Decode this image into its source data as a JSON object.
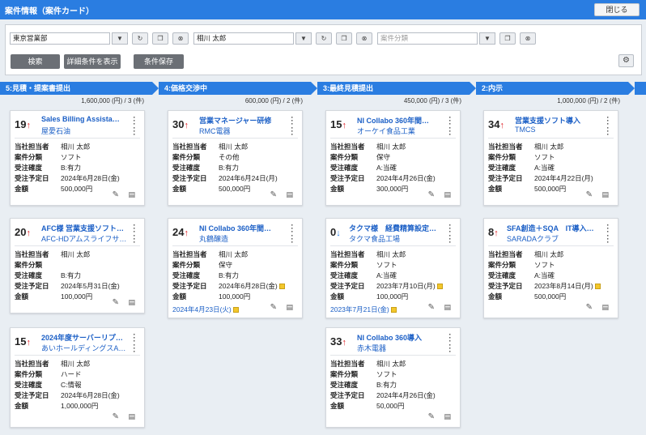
{
  "header": {
    "title": "案件情報（案件カード）",
    "close_label": "閉じる"
  },
  "filter": {
    "department": "東京営業部",
    "person": "相川 太郎",
    "category_placeholder": "案件分類",
    "search_label": "検索",
    "detail_label": "詳細条件を表示",
    "save_label": "条件保存"
  },
  "stages": [
    {
      "label": "5:見積・提案書提出",
      "summary": "1,600,000 (円) / 3 (件)"
    },
    {
      "label": "4:価格交渉中",
      "summary": "600,000 (円) / 2 (件)"
    },
    {
      "label": "3:最終見積提出",
      "summary": "450,000 (円) / 3 (件)"
    },
    {
      "label": "2:内示",
      "summary": "1,000,000 (円) / 2 (件)"
    }
  ],
  "field_labels": {
    "owner": "当社担当者",
    "category": "案件分類",
    "certainty": "受注確度",
    "due": "受注予定日",
    "amount": "金額"
  },
  "cards": [
    {
      "prob": "19",
      "name": "Sales Billing Assista…",
      "company": "屋愛石油",
      "owner": "相川 太郎",
      "category": "ソフト",
      "certainty": "B:有力",
      "due": "2024年6月28日(金)",
      "amount": "500,000円",
      "date": ""
    },
    {
      "prob": "20",
      "name": "AFC様 営業支援ソフト…",
      "company": "AFC-HDアムスライフサ…",
      "owner": "相川 太郎",
      "category": "",
      "certainty": "B:有力",
      "due": "2024年5月31日(金)",
      "amount": "100,000円",
      "date": ""
    },
    {
      "prob": "15",
      "name": "2024年度サーバーリプ…",
      "company": "あいホールディングスA…",
      "owner": "相川 太郎",
      "category": "ハード",
      "certainty": "C:情報",
      "due": "2024年6月28日(金)",
      "amount": "1,000,000円",
      "date": ""
    },
    {
      "prob": "30",
      "name": "営業マネージャー研修",
      "company": "RMC電器",
      "owner": "相川 太郎",
      "category": "その他",
      "certainty": "B:有力",
      "due": "2024年6月24日(月)",
      "amount": "500,000円",
      "date": ""
    },
    {
      "prob": "24",
      "name": "NI Collabo 360年間…",
      "company": "丸鶴醸造",
      "owner": "相川 太郎",
      "category": "保守",
      "certainty": "B:有力",
      "due": "2024年6月28日(金)",
      "amount": "100,000円",
      "date": "2024年4月23日(火)"
    },
    {
      "prob": "15",
      "name": "NI Collabo 360年間…",
      "company": "オーケイ食品工業",
      "owner": "相川 太郎",
      "category": "保守",
      "certainty": "A:当確",
      "due": "2024年4月26日(金)",
      "amount": "300,000円",
      "date": ""
    },
    {
      "prob": "0",
      "name": "タクマ様　経費精算設定…",
      "company": "タクマ食品工場",
      "owner": "相川 太郎",
      "category": "ソフト",
      "certainty": "A:当確",
      "due": "2023年7月10日(月)",
      "amount": "100,000円",
      "date": "2023年7月21日(金)"
    },
    {
      "prob": "33",
      "name": "NI Collabo 360導入",
      "company": "赤木電器",
      "owner": "相川 太郎",
      "category": "ソフト",
      "certainty": "B:有力",
      "due": "2024年4月26日(金)",
      "amount": "50,000円",
      "date": ""
    },
    {
      "prob": "34",
      "name": "営業支援ソフト導入",
      "company": "TMCS",
      "owner": "相川 太郎",
      "category": "ソフト",
      "certainty": "A:当確",
      "due": "2024年4月22日(月)",
      "amount": "500,000円",
      "date": ""
    },
    {
      "prob": "8",
      "name": "SFA創造＋SQA　IT導入…",
      "company": "SARADAクラブ",
      "owner": "相川 太郎",
      "category": "ソフト",
      "certainty": "A:当確",
      "due": "2023年8月14日(月)",
      "amount": "500,000円",
      "date": ""
    }
  ]
}
